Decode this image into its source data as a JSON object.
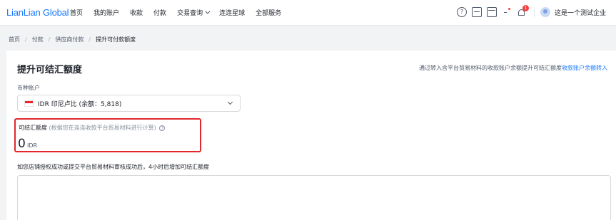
{
  "header": {
    "logo": "LianLian Global",
    "nav": [
      "首页",
      "我的账户",
      "收款",
      "付款",
      "交易查询",
      "连连星球",
      "全部服务"
    ],
    "nav_dropdown_item": "交易查询",
    "icons": [
      "help-icon",
      "document-icon",
      "calendar-icon",
      "dot-icon",
      "bell-icon"
    ],
    "notification_badge": "1",
    "company": "这是一个测试企业"
  },
  "breadcrumb": {
    "items": [
      "首页",
      "付款",
      "供应商付款"
    ],
    "current": "提升可付款额度",
    "separator": "/"
  },
  "main": {
    "title": "提升可结汇额度",
    "tip_text": "通过转入含平台贸易材料的收款账户余额提升可结汇额度",
    "tip_link": "收款账户余额转入",
    "currency_label": "币种账户",
    "currency_value": "IDR 印尼卢比 (余额：5,818)",
    "quota_label": "可结汇额度",
    "quota_note": "(根据您在连连收款平台贸易材料进行计算)",
    "quota_help": "?",
    "quota_amount": "0",
    "quota_unit": "IDR",
    "apply_label": "如您店铺授权成功或提交平台贸易材料审核成功后，4小时后增加可结汇额度"
  },
  "colors": {
    "brand": "#1677ff",
    "highlight_border": "#e0282e",
    "badge": "#f53f3f"
  }
}
